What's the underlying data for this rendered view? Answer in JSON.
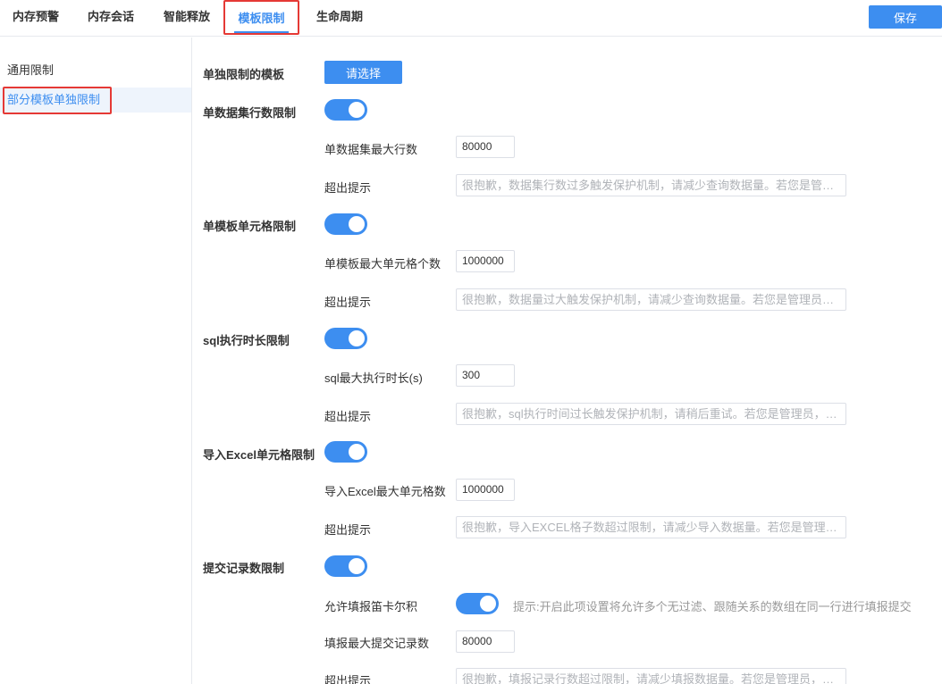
{
  "tabs": [
    {
      "label": "内存预警"
    },
    {
      "label": "内存会话"
    },
    {
      "label": "智能释放"
    },
    {
      "label": "模板限制"
    },
    {
      "label": "生命周期"
    }
  ],
  "active_tab": "模板限制",
  "save_label": "保存",
  "sidebar": {
    "items": [
      {
        "label": "通用限制"
      },
      {
        "label": "部分模板单独限制"
      }
    ],
    "active": "部分模板单独限制"
  },
  "template_select": {
    "label": "单独限制的模板",
    "button": "请选择"
  },
  "sections": {
    "dataset": {
      "label": "单数据集行数限制",
      "enabled": true,
      "max_label": "单数据集最大行数",
      "max_value": "80000",
      "tip_label": "超出提示",
      "tip_text": "很抱歉，数据集行数过多触发保护机制，请减少查询数据量。若您是管…"
    },
    "cells": {
      "label": "单模板单元格限制",
      "enabled": true,
      "max_label": "单模板最大单元格个数",
      "max_value": "1000000",
      "tip_label": "超出提示",
      "tip_text": "很抱歉，数据量过大触发保护机制，请减少查询数据量。若您是管理员…"
    },
    "sql": {
      "label": "sql执行时长限制",
      "enabled": true,
      "max_label": "sql最大执行时长(s)",
      "max_value": "300",
      "tip_label": "超出提示",
      "tip_text": "很抱歉，sql执行时间过长触发保护机制，请稍后重试。若您是管理员，…"
    },
    "excel": {
      "label": "导入Excel单元格限制",
      "enabled": true,
      "max_label": "导入Excel最大单元格数",
      "max_value": "1000000",
      "tip_label": "超出提示",
      "tip_text": "很抱歉，导入EXCEL格子数超过限制，请减少导入数据量。若您是管理…"
    },
    "submit": {
      "label": "提交记录数限制",
      "enabled": true,
      "cartesian_label": "允许填报笛卡尔积",
      "cartesian_enabled": true,
      "cartesian_hint": "提示:开启此项设置将允许多个无过滤、跟随关系的数组在同一行进行填报提交",
      "max_label": "填报最大提交记录数",
      "max_value": "80000",
      "tip_label": "超出提示",
      "tip_text": "很抱歉，填报记录行数超过限制，请减少填报数据量。若您是管理员，…"
    }
  },
  "colors": {
    "accent": "#3d8ef0",
    "highlight_box": "#e53935",
    "border": "#dcdfe6",
    "placeholder_text": "#b0b3b8"
  }
}
